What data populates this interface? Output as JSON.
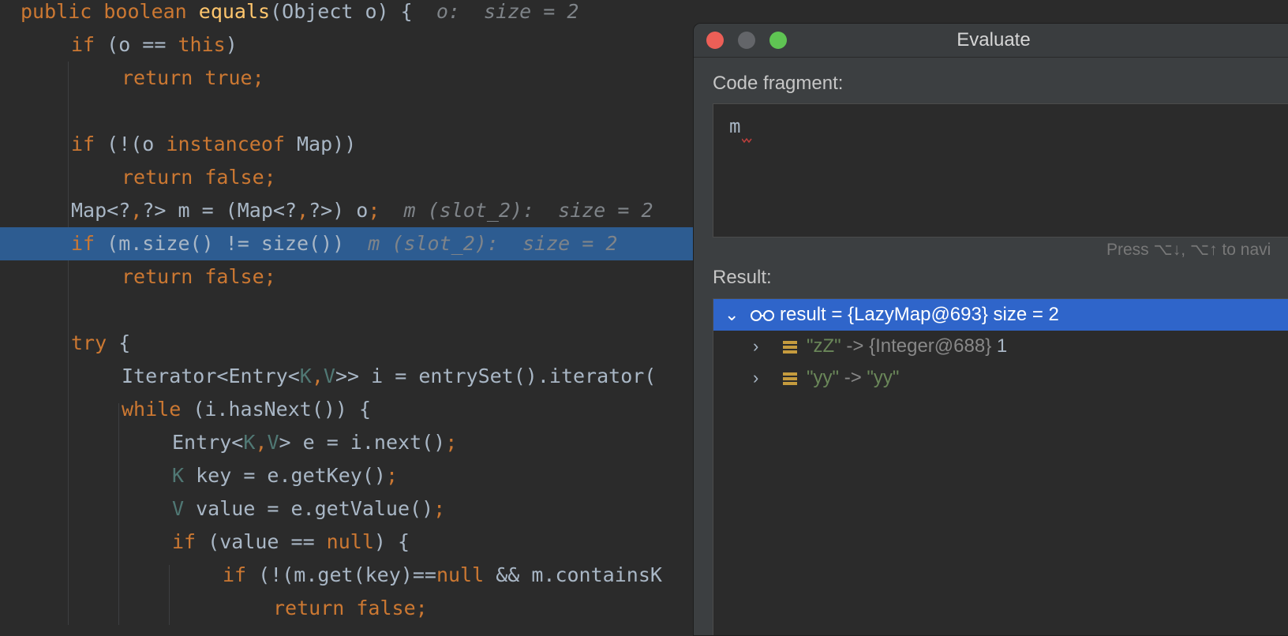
{
  "editor": {
    "lines": [
      {
        "s": [
          {
            "c": "kw",
            "t": "public boolean "
          },
          {
            "c": "fn",
            "t": "equals"
          },
          {
            "c": "pl",
            "t": "(Object o) {  "
          },
          {
            "c": "in",
            "t": "o:  size = 2"
          }
        ]
      },
      {
        "s": [
          {
            "c": "kw",
            "t": "if "
          },
          {
            "c": "pl",
            "t": "(o == "
          },
          {
            "c": "kw",
            "t": "this"
          },
          {
            "c": "pl",
            "t": ")"
          }
        ]
      },
      {
        "s": [
          {
            "c": "kw",
            "t": "return true;"
          }
        ]
      },
      {
        "s": []
      },
      {
        "s": [
          {
            "c": "kw",
            "t": "if "
          },
          {
            "c": "pl",
            "t": "(!(o "
          },
          {
            "c": "kw",
            "t": "instanceof "
          },
          {
            "c": "pl",
            "t": "Map))"
          }
        ]
      },
      {
        "s": [
          {
            "c": "kw",
            "t": "return false;"
          }
        ]
      },
      {
        "s": [
          {
            "c": "pl",
            "t": "Map<?"
          },
          {
            "c": "kw",
            "t": ","
          },
          {
            "c": "pl",
            "t": "?> m = (Map<?"
          },
          {
            "c": "kw",
            "t": ","
          },
          {
            "c": "pl",
            "t": "?>) o"
          },
          {
            "c": "kw",
            "t": ";  "
          },
          {
            "c": "in",
            "t": "m (slot_2):  size = 2"
          }
        ]
      },
      {
        "s": [
          {
            "c": "kw",
            "t": "if "
          },
          {
            "c": "pl",
            "t": "(m.size() != size())  "
          },
          {
            "c": "in",
            "t": "m (slot_2):  size = 2"
          }
        ]
      },
      {
        "s": [
          {
            "c": "kw",
            "t": "return false;"
          }
        ]
      },
      {
        "s": []
      },
      {
        "s": [
          {
            "c": "kw",
            "t": "try "
          },
          {
            "c": "pl",
            "t": "{"
          }
        ]
      },
      {
        "s": [
          {
            "c": "pl",
            "t": "Iterator<Entry<"
          },
          {
            "c": "tp",
            "t": "K"
          },
          {
            "c": "kw",
            "t": ","
          },
          {
            "c": "tp",
            "t": "V"
          },
          {
            "c": "pl",
            "t": ">> i = entrySet().iterator("
          }
        ]
      },
      {
        "s": [
          {
            "c": "kw",
            "t": "while "
          },
          {
            "c": "pl",
            "t": "(i.hasNext()) {"
          }
        ]
      },
      {
        "s": [
          {
            "c": "pl",
            "t": "Entry<"
          },
          {
            "c": "tp",
            "t": "K"
          },
          {
            "c": "kw",
            "t": ","
          },
          {
            "c": "tp",
            "t": "V"
          },
          {
            "c": "pl",
            "t": "> e = i.next()"
          },
          {
            "c": "kw",
            "t": ";"
          }
        ]
      },
      {
        "s": [
          {
            "c": "tp",
            "t": "K "
          },
          {
            "c": "pl",
            "t": "key = e.getKey()"
          },
          {
            "c": "kw",
            "t": ";"
          }
        ]
      },
      {
        "s": [
          {
            "c": "tp",
            "t": "V "
          },
          {
            "c": "pl",
            "t": "value = e.getValue()"
          },
          {
            "c": "kw",
            "t": ";"
          }
        ]
      },
      {
        "s": [
          {
            "c": "kw",
            "t": "if "
          },
          {
            "c": "pl",
            "t": "(value == "
          },
          {
            "c": "kw",
            "t": "null"
          },
          {
            "c": "pl",
            "t": ") {"
          }
        ]
      },
      {
        "s": [
          {
            "c": "kw",
            "t": "if "
          },
          {
            "c": "pl",
            "t": "(!(m.get(key)=="
          },
          {
            "c": "kw",
            "t": "null "
          },
          {
            "c": "pl",
            "t": "&& m.containsK"
          }
        ]
      },
      {
        "s": [
          {
            "c": "kw",
            "t": "return false;"
          }
        ]
      }
    ]
  },
  "dialog": {
    "title": "Evaluate",
    "code_label": "Code fragment:",
    "code_value": "m",
    "hint": "Press ⌥↓, ⌥↑ to navi",
    "result_label": "Result:",
    "result": {
      "text": "result = {LazyMap@693}  size = 2",
      "children": [
        {
          "key": "\"zZ\"",
          "arrow": "->",
          "type": "{Integer@688}",
          "value": "1"
        },
        {
          "key": "\"yy\"",
          "arrow": "->",
          "type": "",
          "value": "\"yy\""
        }
      ]
    }
  },
  "colors": {
    "editor_bg": "#2b2b2b",
    "keyword": "#cc7832",
    "function": "#ffc66d",
    "plain": "#a9b7c6",
    "type_param": "#507874",
    "inlay": "#7f8489",
    "highlight": "#2d5c91",
    "selection": "#2f65ca",
    "string": "#6a8759",
    "close": "#ec5f57",
    "minimize": "#636569",
    "zoom": "#5fc453"
  }
}
